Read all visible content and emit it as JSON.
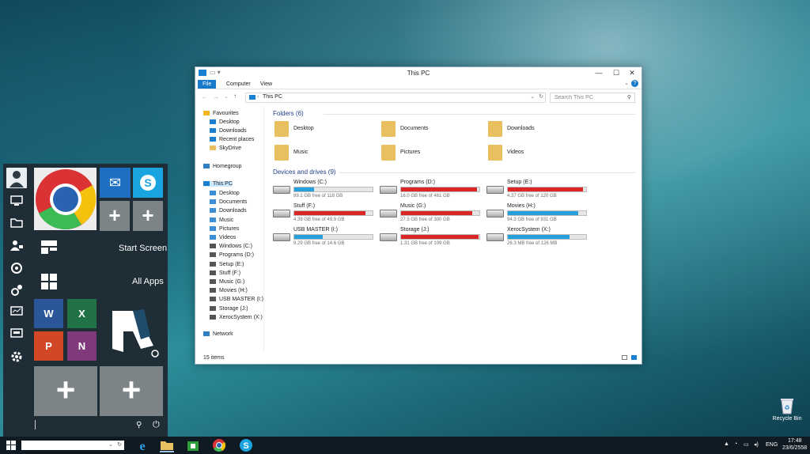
{
  "start_menu": {
    "start_screen_label": "Start Screen",
    "all_apps_label": "All Apps",
    "tiles": {
      "word": "W",
      "excel": "X",
      "powerpoint": "P",
      "onenote": "N"
    }
  },
  "explorer": {
    "title": "This PC",
    "ribbon_tabs": [
      "File",
      "Computer",
      "View"
    ],
    "address": "This PC",
    "search_placeholder": "Search This PC",
    "nav": {
      "favourites": "Favourites",
      "favourites_items": [
        "Desktop",
        "Downloads",
        "Recent places",
        "SkyDrive"
      ],
      "homegroup": "Homegroup",
      "this_pc": "This PC",
      "this_pc_items": [
        "Desktop",
        "Documents",
        "Downloads",
        "Music",
        "Pictures",
        "Videos",
        "Windows (C:)",
        "Programs (D:)",
        "Setup (E:)",
        "Stuff (F:)",
        "Music (G:)",
        "Movies (H:)",
        "USB MASTER (I:)",
        "Storage (J:)",
        "XerocSystem (X:)"
      ],
      "network": "Network"
    },
    "folders_header": "Folders (6)",
    "folders": [
      "Desktop",
      "Documents",
      "Downloads",
      "Music",
      "Pictures",
      "Videos"
    ],
    "drives_header": "Devices and drives (9)",
    "drives": [
      {
        "name": "Windows (C:)",
        "free": "89.1 GB free of 118 GB",
        "used": 0.25,
        "color": "#26a0da"
      },
      {
        "name": "Programs (D:)",
        "free": "16.0 GB free of 461 GB",
        "used": 0.97,
        "color": "#da2626"
      },
      {
        "name": "Setup (E:)",
        "free": "4.37 GB free of 120 GB",
        "used": 0.96,
        "color": "#da2626"
      },
      {
        "name": "Stuff (F:)",
        "free": "4.39 GB free of 49.9 GB",
        "used": 0.91,
        "color": "#da2626"
      },
      {
        "name": "Music (G:)",
        "free": "27.5 GB free of 300 GB",
        "used": 0.91,
        "color": "#da2626"
      },
      {
        "name": "Movies (H:)",
        "free": "94.3 GB free of 931 GB",
        "used": 0.9,
        "color": "#26a0da"
      },
      {
        "name": "USB MASTER (I:)",
        "free": "9.29 GB free of 14.6 GB",
        "used": 0.36,
        "color": "#26a0da"
      },
      {
        "name": "Storage (J:)",
        "free": "1.31 GB free of 109 GB",
        "used": 0.99,
        "color": "#da2626"
      },
      {
        "name": "XerocSystem (X:)",
        "free": "26.3 MB free of 126 MB",
        "used": 0.79,
        "color": "#26a0da"
      }
    ],
    "status": "15 items"
  },
  "desktop": {
    "recycle_bin": "Recycle Bin"
  },
  "taskbar": {
    "lang": "ENG",
    "time": "17:48",
    "date": "23/6/2558"
  }
}
